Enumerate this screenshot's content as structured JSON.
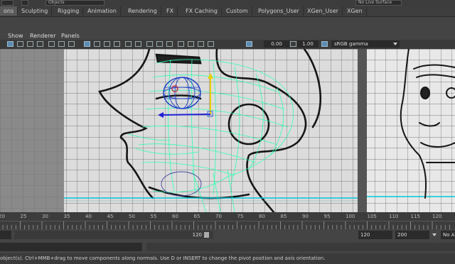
{
  "top": {
    "selection_mask": "Objects",
    "live_surface": "No Live Surface"
  },
  "shelf": {
    "tabs": [
      "ons",
      "Sculpting",
      "Rigging",
      "Animation",
      "Rendering",
      "FX",
      "FX Caching",
      "Custom",
      "Polygons_User",
      "XGen_User",
      "XGen"
    ],
    "active_tab": "ons"
  },
  "panel_menu": {
    "show": "Show",
    "renderer": "Renderer",
    "panels": "Panels"
  },
  "panel_toolbar": {
    "exposure": "0.00",
    "gamma": "1.00",
    "color_space": "sRGB gamma"
  },
  "time_slider": {
    "ticks": [
      "20",
      "25",
      "30",
      "35",
      "40",
      "45",
      "50",
      "55",
      "60",
      "65",
      "70",
      "75",
      "80",
      "85",
      "90",
      "95",
      "100",
      "105",
      "110",
      "115",
      "120"
    ]
  },
  "range_slider": {
    "range_end": "120",
    "end_time": "120",
    "anim_end": "200",
    "anim_layer": "No A"
  },
  "help_line": {
    "text": "object(s). Ctrl+MMB+drag to move components along normals. Use D or INSERT to change the pivot position and axis orientation."
  },
  "colors": {
    "wireframe": "#2dffb0",
    "guide_line": "#00c8d8",
    "viewport_bg": "#9a9a9a"
  }
}
